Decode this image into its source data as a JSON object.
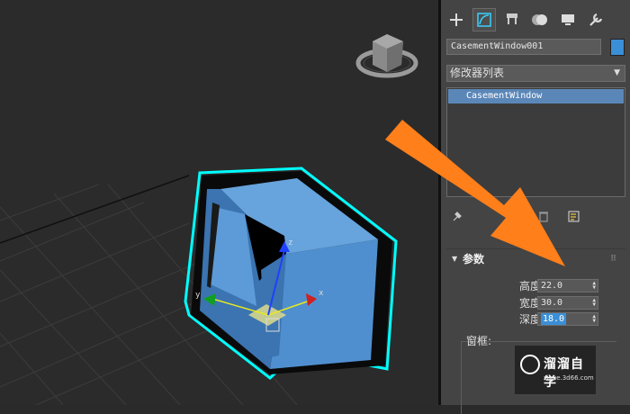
{
  "command_panel": {
    "tabs": [
      {
        "name": "create",
        "icon": "plus-icon"
      },
      {
        "name": "modify",
        "icon": "modify-icon"
      },
      {
        "name": "hierarchy",
        "icon": "hierarchy-icon"
      },
      {
        "name": "motion",
        "icon": "motion-icon"
      },
      {
        "name": "display",
        "icon": "display-icon"
      },
      {
        "name": "utilities",
        "icon": "wrench-icon"
      }
    ],
    "active_tab": "modify",
    "object_name": "CasementWindow001",
    "object_color": "#3a8fd6",
    "modifier_list_label": "修改器列表",
    "modifier_stack": [
      "CasementWindow"
    ],
    "rollout": {
      "title": "参数",
      "params": [
        {
          "label": "高度:",
          "value": "22.0"
        },
        {
          "label": "宽度:",
          "value": "30.0"
        },
        {
          "label": "深度:",
          "value": "18.0",
          "selected": true
        }
      ],
      "group_label": "窗框:"
    }
  },
  "viewport": {
    "axis_labels": {
      "x": "x",
      "y": "y",
      "z": "z"
    },
    "object_color": "#5a9ad8",
    "selection_color": "#00ffff"
  },
  "watermark": {
    "brand": "溜溜自学",
    "site": "zixue.3d66.com"
  },
  "accent_arrow_color": "#ff7f1a"
}
